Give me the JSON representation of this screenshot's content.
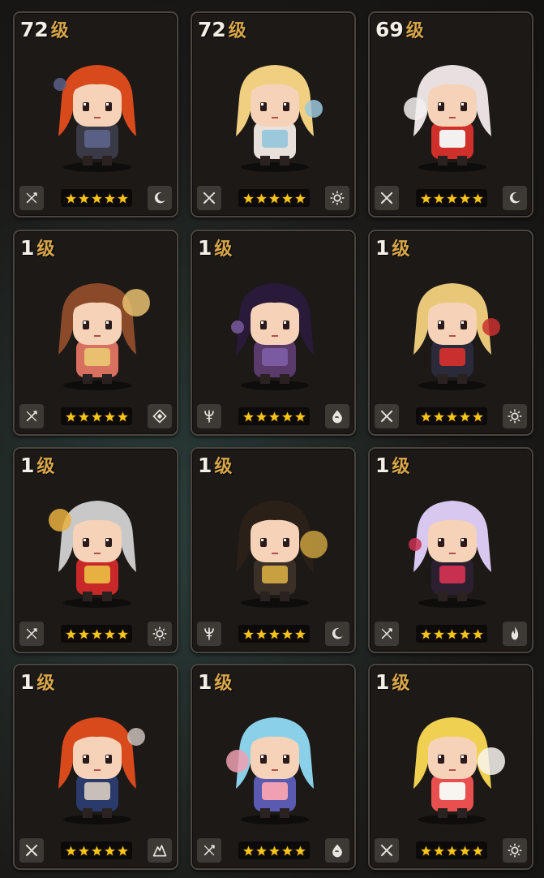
{
  "level_unit": "级",
  "heroes": [
    {
      "level": "72",
      "stars": 5,
      "class_icon": "staff-icon",
      "element_icon": "moon-icon",
      "hair": "#d84a1c",
      "outfit": "#3a3a46",
      "accent": "#5a5f86"
    },
    {
      "level": "72",
      "stars": 5,
      "class_icon": "swords-icon",
      "element_icon": "sun-icon",
      "hair": "#f0d080",
      "outfit": "#e8e0da",
      "accent": "#9cc8dc"
    },
    {
      "level": "69",
      "stars": 5,
      "class_icon": "swords-icon",
      "element_icon": "moon-icon",
      "hair": "#e8e0e0",
      "outfit": "#d0302a",
      "accent": "#f4f0f0"
    },
    {
      "level": "1",
      "stars": 5,
      "class_icon": "staff-icon",
      "element_icon": "wind-icon",
      "hair": "#8a4a2a",
      "outfit": "#d87060",
      "accent": "#e8c070"
    },
    {
      "level": "1",
      "stars": 5,
      "class_icon": "trident-icon",
      "element_icon": "water-icon",
      "hair": "#2a1a3a",
      "outfit": "#5a3a6a",
      "accent": "#7a5aa0"
    },
    {
      "level": "1",
      "stars": 5,
      "class_icon": "swords-icon",
      "element_icon": "sun-icon",
      "hair": "#e8c878",
      "outfit": "#2a2a3a",
      "accent": "#c83030"
    },
    {
      "level": "1",
      "stars": 5,
      "class_icon": "staff-icon",
      "element_icon": "sun-icon",
      "hair": "#c8c8c8",
      "outfit": "#c82828",
      "accent": "#e8b040"
    },
    {
      "level": "1",
      "stars": 5,
      "class_icon": "trident-icon",
      "element_icon": "moon-icon",
      "hair": "#2a2018",
      "outfit": "#3a3028",
      "accent": "#c8a040"
    },
    {
      "level": "1",
      "stars": 5,
      "class_icon": "staff-icon",
      "element_icon": "fire-icon",
      "hair": "#d8c8f0",
      "outfit": "#2a2030",
      "accent": "#c83050"
    },
    {
      "level": "1",
      "stars": 5,
      "class_icon": "swords-icon",
      "element_icon": "mountain-icon",
      "hair": "#d84a1c",
      "outfit": "#2a3a6a",
      "accent": "#c8c0b8"
    },
    {
      "level": "1",
      "stars": 5,
      "class_icon": "staff-icon",
      "element_icon": "water-icon",
      "hair": "#8ad0e8",
      "outfit": "#5a5ab0",
      "accent": "#f0a0b0"
    },
    {
      "level": "1",
      "stars": 5,
      "class_icon": "swords-icon",
      "element_icon": "sun-icon",
      "hair": "#f0d050",
      "outfit": "#e85050",
      "accent": "#f8f4f0"
    }
  ],
  "colors": {
    "level_text": "#f4efe6",
    "level_unit": "#d8a64a",
    "star_gold": "#f5c518",
    "star_dim": "#7a5a14",
    "icon_fg": "#e8e4df"
  }
}
